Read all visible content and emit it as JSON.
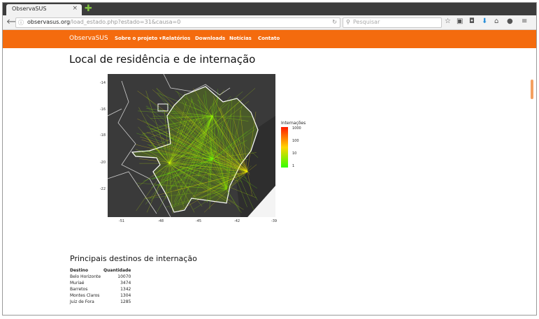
{
  "browser": {
    "tab_title": "ObservaSUS",
    "tab_close": "×",
    "new_tab": "✚",
    "url_host": "observasus.org",
    "url_path": "/load_estado.php?estado=31&causa=0",
    "search_placeholder": "Pesquisar"
  },
  "site": {
    "brand": "ObservaSUS",
    "menu": [
      {
        "label": "Sobre o projeto ▾"
      },
      {
        "label": "Relatórios"
      },
      {
        "label": "Downloads"
      },
      {
        "label": "Notícias"
      },
      {
        "label": "Contato"
      }
    ],
    "accent": "#f46b0e"
  },
  "main": {
    "title": "Local de residência e de internação",
    "subtitle": "Principais destinos de internação"
  },
  "chart_data": {
    "type": "flow-map",
    "y_ticks": [
      "-14",
      "-16",
      "-18",
      "-20",
      "-22"
    ],
    "x_ticks": [
      "-51",
      "-48",
      "-45",
      "-42",
      "-39"
    ],
    "xlim": [
      -51.5,
      -39
    ],
    "ylim": [
      -23.8,
      -13.4
    ],
    "legend": {
      "title": "Internações",
      "labels": [
        "1000",
        "100",
        "10",
        "1"
      ],
      "colors": [
        "#ff1a00",
        "#ffd400",
        "#33ff00"
      ],
      "scale": "log"
    }
  },
  "table": {
    "headers": [
      "Destino",
      "Quantidade"
    ],
    "rows": [
      [
        "Belo Horizonte",
        "10070"
      ],
      [
        "Muriaé",
        "3474"
      ],
      [
        "Barretos",
        "1342"
      ],
      [
        "Montes Claros",
        "1304"
      ],
      [
        "Juiz de Fora",
        "1285"
      ]
    ]
  }
}
